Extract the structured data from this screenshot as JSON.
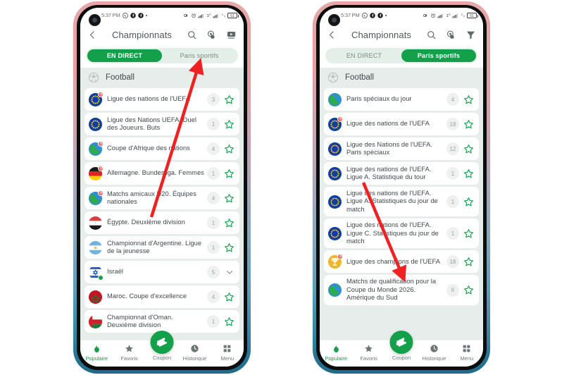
{
  "phones": [
    {
      "id": "left",
      "statusbar": {
        "time": "5:37 PM",
        "icons": [
          "whatsapp-icon",
          "facebook-icon",
          "facebook-icon",
          "dot-icon"
        ],
        "right_icons": [
          "vibrate-icon",
          "alarm-icon",
          "signal-icon",
          "sim-icon",
          "signal2-icon",
          "sync-icon"
        ],
        "battery": "51"
      },
      "appbar": {
        "back": "back-arrow-icon",
        "title": "Championnats",
        "icons": [
          "search-icon",
          "tap-finger-icon",
          "tv-icon"
        ]
      },
      "tabs": [
        {
          "label": "EN DIRECT",
          "active": true
        },
        {
          "label": "Paris sportifs",
          "active": false
        }
      ],
      "section": {
        "icon": "soccer-ball-icon",
        "label": "Football"
      },
      "rows": [
        {
          "title": "Ligue des nations de l'UEFA",
          "count": "3",
          "flag": "eu",
          "badge": "red",
          "trailing": "star",
          "lines": 1
        },
        {
          "title": "Ligue des Nations UEFA. Duel des Joueurs. Buts",
          "count": "1",
          "flag": "eu",
          "badge": "none",
          "trailing": "star",
          "lines": 2
        },
        {
          "title": "Coupe d'Afrique des nations",
          "count": "4",
          "flag": "globe-africa",
          "badge": "red",
          "trailing": "star",
          "lines": 1
        },
        {
          "title": "Allemagne. Bundesliga. Femmes",
          "count": "1",
          "flag": "germany",
          "badge": "red",
          "trailing": "star",
          "lines": 2
        },
        {
          "title": "Matchs amicaux U20. Équipes nationales",
          "count": "4",
          "flag": "globe-africa",
          "badge": "red",
          "trailing": "star",
          "lines": 2
        },
        {
          "title": "Égypte. Deuxième division",
          "count": "1",
          "flag": "egypt",
          "badge": "none",
          "trailing": "star",
          "lines": 1
        },
        {
          "title": "Championnat d'Argentine. Ligue de la jeunesse",
          "count": "1",
          "flag": "argentina",
          "badge": "none",
          "trailing": "star",
          "lines": 2
        },
        {
          "title": "Israël",
          "count": "5",
          "flag": "israel",
          "badge": "green",
          "trailing": "chevron",
          "lines": 1
        },
        {
          "title": "Maroc. Coupe d'excellence",
          "count": "4",
          "flag": "morocco",
          "badge": "none",
          "trailing": "star",
          "lines": 1
        },
        {
          "title": "Championnat d'Oman. Deuxième division",
          "count": "1",
          "flag": "oman",
          "badge": "none",
          "trailing": "star",
          "lines": 2
        }
      ],
      "bottomnav": [
        {
          "label": "Populaire",
          "icon": "flame-icon",
          "active": true
        },
        {
          "label": "Favoris",
          "icon": "star-icon",
          "active": false
        },
        {
          "label": "Coupon",
          "icon": "ticket-icon",
          "active": false
        },
        {
          "label": "Historique",
          "icon": "clock-icon",
          "active": false
        },
        {
          "label": "Menu",
          "icon": "grid-icon",
          "active": false
        }
      ]
    },
    {
      "id": "right",
      "statusbar": {
        "time": "5:37 PM",
        "icons": [
          "whatsapp-icon",
          "facebook-icon",
          "facebook-icon",
          "dot-icon"
        ],
        "right_icons": [
          "vibrate-icon",
          "alarm-icon",
          "signal-icon",
          "sim-icon",
          "signal2-icon",
          "sync-icon"
        ],
        "battery": "51"
      },
      "appbar": {
        "back": "back-arrow-icon",
        "title": "Championnats",
        "icons": [
          "search-icon",
          "tap-finger-icon",
          "filter-icon"
        ]
      },
      "tabs": [
        {
          "label": "EN DIRECT",
          "active": false
        },
        {
          "label": "Paris sportifs",
          "active": true
        }
      ],
      "section": {
        "icon": "soccer-ball-icon",
        "label": "Football"
      },
      "rows": [
        {
          "title": "Paris spéciaux du jour",
          "count": "4",
          "flag": "globe-africa",
          "badge": "none",
          "trailing": "star",
          "lines": 1
        },
        {
          "title": "Ligue des nations de l'UEFA",
          "count": "18",
          "flag": "eu",
          "badge": "red",
          "trailing": "star",
          "lines": 1
        },
        {
          "title": "Ligue des Nations de l'UEFA. Paris spéciaux",
          "count": "12",
          "flag": "eu",
          "badge": "none",
          "trailing": "star",
          "lines": 2
        },
        {
          "title": "Ligue des nations de l'UEFA. Ligue A. Statistique du tour",
          "count": "1",
          "flag": "eu",
          "badge": "none",
          "trailing": "star",
          "lines": 2
        },
        {
          "title": "Ligue des nations de l'UEFA. Ligue A. Statistiques du jour de match",
          "count": "1",
          "flag": "eu",
          "badge": "none",
          "trailing": "star",
          "lines": 3
        },
        {
          "title": "Ligue des nations de l'UEFA. Ligue C. Statistiques du jour de match",
          "count": "1",
          "flag": "eu",
          "badge": "none",
          "trailing": "star",
          "lines": 3
        },
        {
          "title": "Ligue des champions de l'UEFA",
          "count": "18",
          "flag": "trophy",
          "badge": "red",
          "trailing": "star",
          "lines": 2
        },
        {
          "title": "Matchs de qualification pour la Coupe du Monde 2026. Amérique du Sud",
          "count": "6",
          "flag": "globe-africa",
          "badge": "none",
          "trailing": "star",
          "lines": 3
        }
      ],
      "bottomnav": [
        {
          "label": "Populaire",
          "icon": "flame-icon",
          "active": true
        },
        {
          "label": "Favoris",
          "icon": "star-icon",
          "active": false
        },
        {
          "label": "Coupon",
          "icon": "ticket-icon",
          "active": false
        },
        {
          "label": "Historique",
          "icon": "clock-icon",
          "active": false
        },
        {
          "label": "Menu",
          "icon": "grid-icon",
          "active": false
        }
      ]
    }
  ],
  "annotations": [
    {
      "name": "arrow-to-paris-sportifs-tab",
      "color": "#ee2222"
    },
    {
      "name": "arrow-to-ligue-des-champions-row",
      "color": "#ee2222"
    }
  ],
  "colors": {
    "accent_green": "#14a04a",
    "tab_track": "#e3efe8",
    "list_bg": "#e7edea",
    "text": "#3e484b",
    "arrow_red": "#ee2222"
  }
}
